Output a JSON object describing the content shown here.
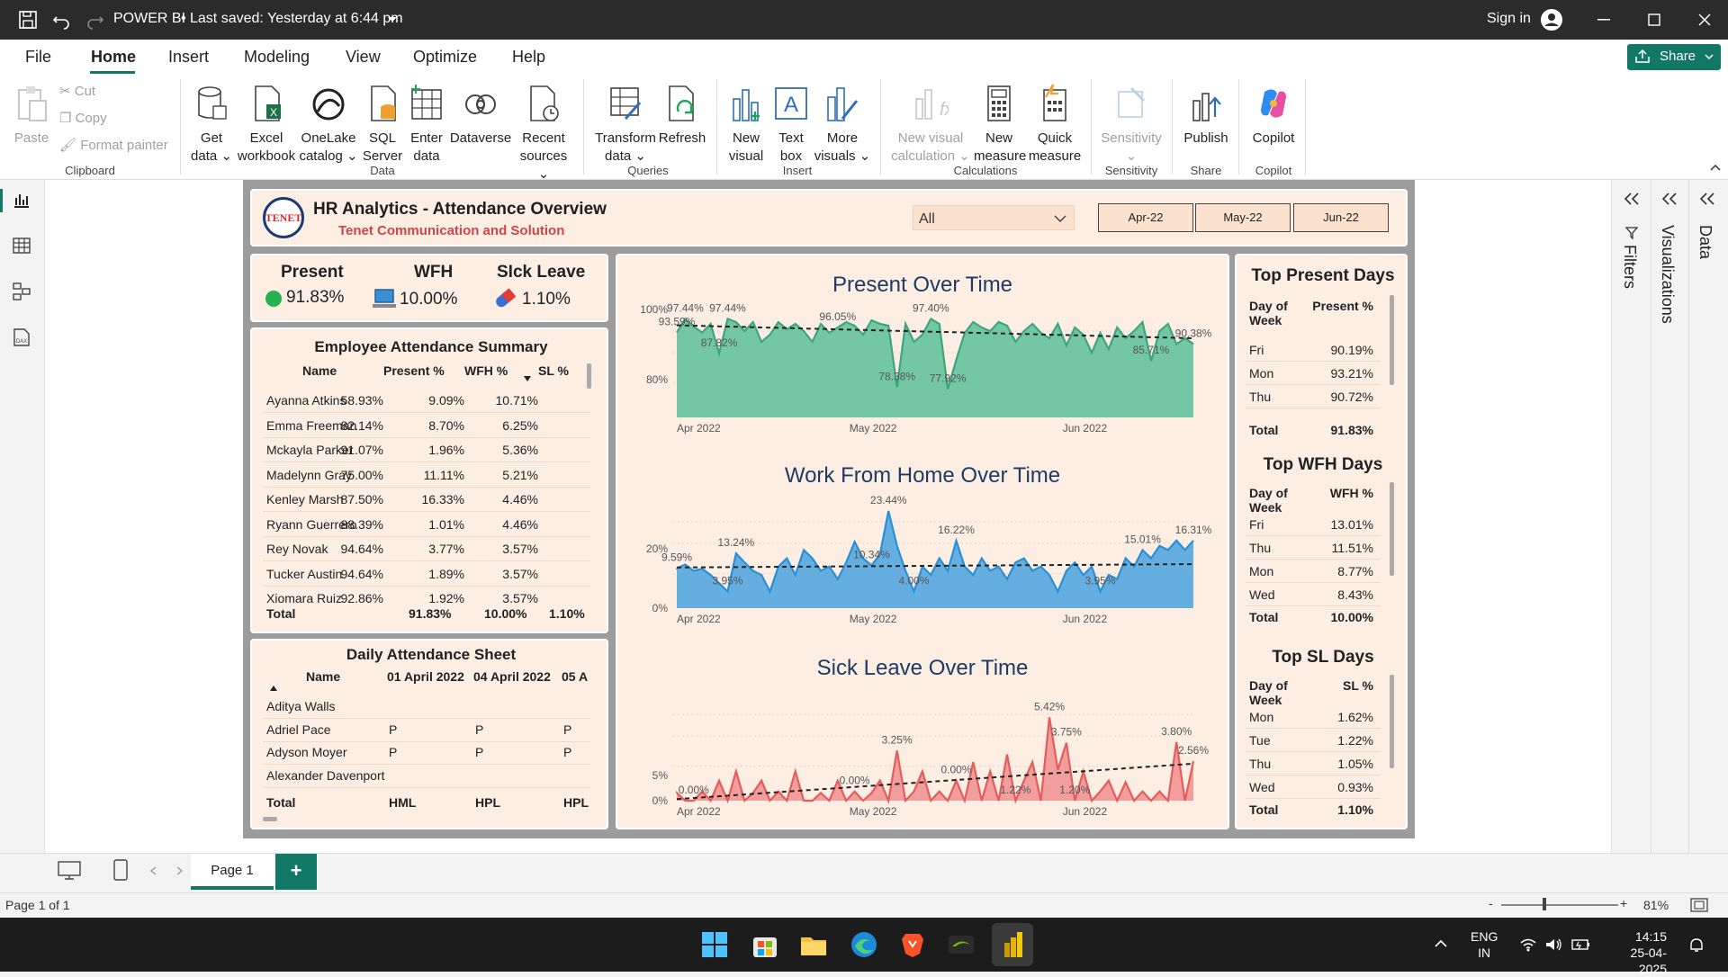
{
  "titlebar": {
    "title": "POWER BI",
    "saved": "Last saved: Yesterday at 6:44 pm",
    "signin": "Sign in"
  },
  "menu": [
    "File",
    "Home",
    "Insert",
    "Modeling",
    "View",
    "Optimize",
    "Help"
  ],
  "share": "Share",
  "ribbon": {
    "clipboard": {
      "paste": "Paste",
      "cut": "Cut",
      "copy": "Copy",
      "format": "Format painter",
      "label": "Clipboard"
    },
    "data": [
      {
        "l1": "Get",
        "l2": "data"
      },
      {
        "l1": "Excel",
        "l2": "workbook"
      },
      {
        "l1": "OneLake",
        "l2": "catalog"
      },
      {
        "l1": "SQL",
        "l2": "Server"
      },
      {
        "l1": "Enter",
        "l2": "data"
      },
      {
        "l1": "Dataverse",
        "l2": ""
      },
      {
        "l1": "Recent",
        "l2": "sources"
      }
    ],
    "data_label": "Data",
    "queries": [
      {
        "l1": "Transform",
        "l2": "data"
      },
      {
        "l1": "Refresh",
        "l2": ""
      }
    ],
    "queries_label": "Queries",
    "insert": [
      {
        "l1": "New",
        "l2": "visual"
      },
      {
        "l1": "Text",
        "l2": "box"
      },
      {
        "l1": "More",
        "l2": "visuals"
      }
    ],
    "insert_label": "Insert",
    "calc": [
      {
        "l1": "New visual",
        "l2": "calculation"
      },
      {
        "l1": "New",
        "l2": "measure"
      },
      {
        "l1": "Quick",
        "l2": "measure"
      }
    ],
    "calc_label": "Calculations",
    "sensitivity": "Sensitivity",
    "sensitivity_label": "Sensitivity",
    "publish": "Publish",
    "share_label": "Share",
    "copilot": "Copilot",
    "copilot_label": "Copilot"
  },
  "report": {
    "logo": "TENET",
    "title": "HR Analytics - Attendance Overview",
    "subtitle": "Tenet Communication and Solution",
    "slicer": "All",
    "months": [
      "Apr-22",
      "May-22",
      "Jun-22"
    ],
    "kpis": [
      {
        "label": "Present",
        "value": "91.83%",
        "color": "#22b14c"
      },
      {
        "label": "WFH",
        "value": "10.00%",
        "color": "#3a8fd6"
      },
      {
        "label": "SIck Leave",
        "value": "1.10%",
        "color": "#e23b3b"
      }
    ],
    "summary": {
      "title": "Employee Attendance Summary",
      "headers": [
        "Name",
        "Present %",
        "WFH %",
        "SL %"
      ],
      "rows": [
        [
          "Ayanna Atkins",
          "58.93%",
          "9.09%",
          "10.71%"
        ],
        [
          "Emma Freeman",
          "82.14%",
          "8.70%",
          "6.25%"
        ],
        [
          "Mckayla Parker",
          "91.07%",
          "1.96%",
          "5.36%"
        ],
        [
          "Madelynn Gray",
          "75.00%",
          "11.11%",
          "5.21%"
        ],
        [
          "Kenley Marsh",
          "87.50%",
          "16.33%",
          "4.46%"
        ],
        [
          "Ryann Guerrero",
          "88.39%",
          "1.01%",
          "4.46%"
        ],
        [
          "Rey Novak",
          "94.64%",
          "3.77%",
          "3.57%"
        ],
        [
          "Tucker Austin",
          "94.64%",
          "1.89%",
          "3.57%"
        ],
        [
          "Xiomara Ruiz",
          "92.86%",
          "1.92%",
          "3.57%"
        ]
      ],
      "total": [
        "Total",
        "91.83%",
        "10.00%",
        "1.10%"
      ]
    },
    "daily": {
      "title": "Daily Attendance Sheet",
      "headers": [
        "Name",
        "01 April 2022",
        "04 April 2022",
        "05 A"
      ],
      "rows": [
        [
          "Aditya Walls",
          "",
          "",
          ""
        ],
        [
          "Adriel Pace",
          "P",
          "P",
          "P"
        ],
        [
          "Adyson Moyer",
          "P",
          "P",
          "P"
        ],
        [
          "Alexander Davenport",
          "",
          "",
          ""
        ]
      ],
      "total": [
        "Total",
        "HML",
        "HPL",
        "HPL"
      ]
    },
    "top_present": {
      "title": "Top Present Days",
      "headers": [
        "Day of Week",
        "Present %"
      ],
      "rows": [
        [
          "Fri",
          "90.19%"
        ],
        [
          "Mon",
          "93.21%"
        ],
        [
          "Thu",
          "90.72%"
        ]
      ],
      "total": [
        "Total",
        "91.83%"
      ]
    },
    "top_wfh": {
      "title": "Top WFH Days",
      "headers": [
        "Day of Week",
        "WFH %"
      ],
      "rows": [
        [
          "Fri",
          "13.01%"
        ],
        [
          "Thu",
          "11.51%"
        ],
        [
          "Mon",
          "8.77%"
        ],
        [
          "Wed",
          "8.43%"
        ]
      ],
      "total": [
        "Total",
        "10.00%"
      ]
    },
    "top_sl": {
      "title": "Top SL Days",
      "headers": [
        "Day of Week",
        "SL %"
      ],
      "rows": [
        [
          "Mon",
          "1.62%"
        ],
        [
          "Tue",
          "1.22%"
        ],
        [
          "Thu",
          "1.05%"
        ],
        [
          "Wed",
          "0.93%"
        ]
      ],
      "total": [
        "Total",
        "1.10%"
      ]
    }
  },
  "chart_data": [
    {
      "type": "area",
      "title": "Present Over Time",
      "x_labels": [
        "Apr 2022",
        "May 2022",
        "Jun 2022"
      ],
      "ylim": [
        70,
        100
      ],
      "yticks": [
        "100%",
        "80%"
      ],
      "color": "#5bbf98",
      "values": [
        93.6,
        97.4,
        95.2,
        93.6,
        96.0,
        87.8,
        97.4,
        96.5,
        94.0,
        96.5,
        91.0,
        93.0,
        96.5,
        94.5,
        96.0,
        94.0,
        91.0,
        96.0,
        93.5,
        95.0,
        96.5,
        95.5,
        93.0,
        97.0,
        96.0,
        95.5,
        78.4,
        96.0,
        91.0,
        93.0,
        97.4,
        96.0,
        77.9,
        86.0,
        93.5,
        96.5,
        95.0,
        94.0,
        96.5,
        95.5,
        91.0,
        94.0,
        96.0,
        93.5,
        92.0,
        96.0,
        90.0,
        95.0,
        93.0,
        88.0,
        93.5,
        89.0,
        95.0,
        92.0,
        94.0,
        96.5,
        85.7,
        94.0,
        96.0,
        90.4,
        92.0,
        90.4
      ],
      "labels": [
        [
          "97.44%",
          1
        ],
        [
          "93.59%",
          0
        ],
        [
          "87.82%",
          5
        ],
        [
          "97.44%",
          6
        ],
        [
          "96.05%",
          19
        ],
        [
          "78.38%",
          26
        ],
        [
          "97.40%",
          30
        ],
        [
          "77.92%",
          32
        ],
        [
          "85.71%",
          56
        ],
        [
          "90.38%",
          61
        ]
      ],
      "trend": [
        95.6,
        92.0
      ]
    },
    {
      "type": "area",
      "title": "Work From Home Over Time",
      "x_labels": [
        "Apr 2022",
        "May 2022",
        "Jun 2022"
      ],
      "ylim": [
        0,
        26
      ],
      "yticks": [
        "20%",
        "0%"
      ],
      "color": "#4aa3df",
      "values": [
        9.6,
        10.5,
        9.0,
        9.5,
        8.0,
        6.0,
        4.0,
        13.2,
        11.0,
        9.0,
        8.0,
        4.0,
        10.0,
        12.0,
        8.0,
        14.0,
        12.0,
        9.0,
        10.0,
        7.0,
        11.0,
        16.0,
        12.0,
        10.3,
        13.0,
        23.4,
        15.0,
        9.0,
        4.0,
        10.0,
        8.0,
        12.0,
        9.0,
        16.2,
        10.0,
        8.0,
        12.0,
        9.0,
        10.0,
        7.0,
        11.0,
        12.0,
        9.0,
        10.0,
        8.0,
        4.0,
        9.0,
        11.0,
        8.0,
        10.0,
        4.0,
        8.0,
        7.0,
        12.0,
        10.0,
        14.0,
        12.0,
        15.0,
        14.0,
        16.3,
        14.0,
        16.3
      ],
      "labels": [
        [
          "9.59%",
          0
        ],
        [
          "3.95%",
          6
        ],
        [
          "13.24%",
          7
        ],
        [
          "10.34%",
          23
        ],
        [
          "23.44%",
          25
        ],
        [
          "4.00%",
          28
        ],
        [
          "16.22%",
          33
        ],
        [
          "3.95%",
          50
        ],
        [
          "15.01%",
          55
        ],
        [
          "16.31%",
          61
        ]
      ],
      "trend": [
        9.8,
        10.6
      ]
    },
    {
      "type": "area",
      "title": "Sick Leave Over Time",
      "x_labels": [
        "Apr 2022",
        "May 2022",
        "Jun 2022"
      ],
      "ylim": [
        0,
        7
      ],
      "yticks": [
        "5%",
        "0%"
      ],
      "color": "#ef8f8f",
      "values": [
        0.5,
        0,
        0,
        0.6,
        0,
        1.3,
        0,
        1.9,
        0,
        0.5,
        1.3,
        0,
        0.6,
        0,
        1.9,
        0,
        0,
        0.5,
        0,
        1.3,
        0,
        0.6,
        0,
        0.5,
        1.3,
        0,
        3.25,
        0,
        0.6,
        1.9,
        0,
        0.6,
        0,
        1.3,
        0,
        2.5,
        0,
        1.9,
        0,
        3.0,
        0,
        1.3,
        2.5,
        0,
        5.4,
        2.0,
        3.75,
        0,
        1.9,
        0,
        0.6,
        1.3,
        0,
        1.2,
        0,
        0.6,
        0,
        0.6,
        0,
        3.8,
        0,
        2.56
      ],
      "labels": [
        [
          "0.00%",
          2
        ],
        [
          "3.25%",
          26
        ],
        [
          "0.00%",
          21
        ],
        [
          "0.00%",
          33
        ],
        [
          "1.22%",
          40
        ],
        [
          "5.42%",
          44
        ],
        [
          "3.75%",
          46
        ],
        [
          "1.20%",
          47
        ],
        [
          "3.80%",
          59
        ],
        [
          "2.56%",
          61
        ]
      ],
      "trend": [
        0.1,
        2.4
      ]
    }
  ],
  "tabs": {
    "page": "Page 1",
    "add": "+"
  },
  "status": {
    "left": "Page 1 of 1",
    "zoom": "81%"
  },
  "taskbar": {
    "lang1": "ENG",
    "lang2": "IN",
    "time": "14:15",
    "date": "25-04-2025"
  },
  "panes": {
    "filters": "Filters",
    "visualizations": "Visualizations",
    "data": "Data"
  }
}
